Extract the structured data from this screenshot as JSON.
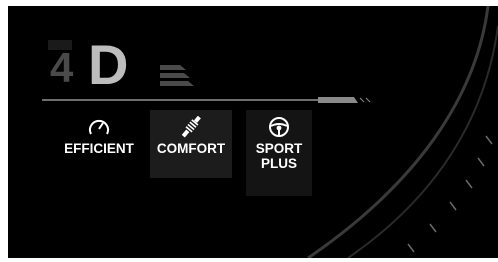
{
  "screen": {
    "gear": {
      "number": "4",
      "letter": "D"
    },
    "drive_modes": [
      {
        "label": "EFFICIENT",
        "icon": "gauge-icon"
      },
      {
        "label": "COMFORT",
        "icon": "shock-absorber-icon"
      },
      {
        "label": "SPORT\nPLUS",
        "icon": "steering-wheel-icon"
      }
    ],
    "selected_mode": "COMFORT",
    "colors": {
      "background": "#000000",
      "gear_letter": "#bdbdbd",
      "gear_number": "#4a4a4a",
      "mode_text": "#ffffff"
    }
  }
}
